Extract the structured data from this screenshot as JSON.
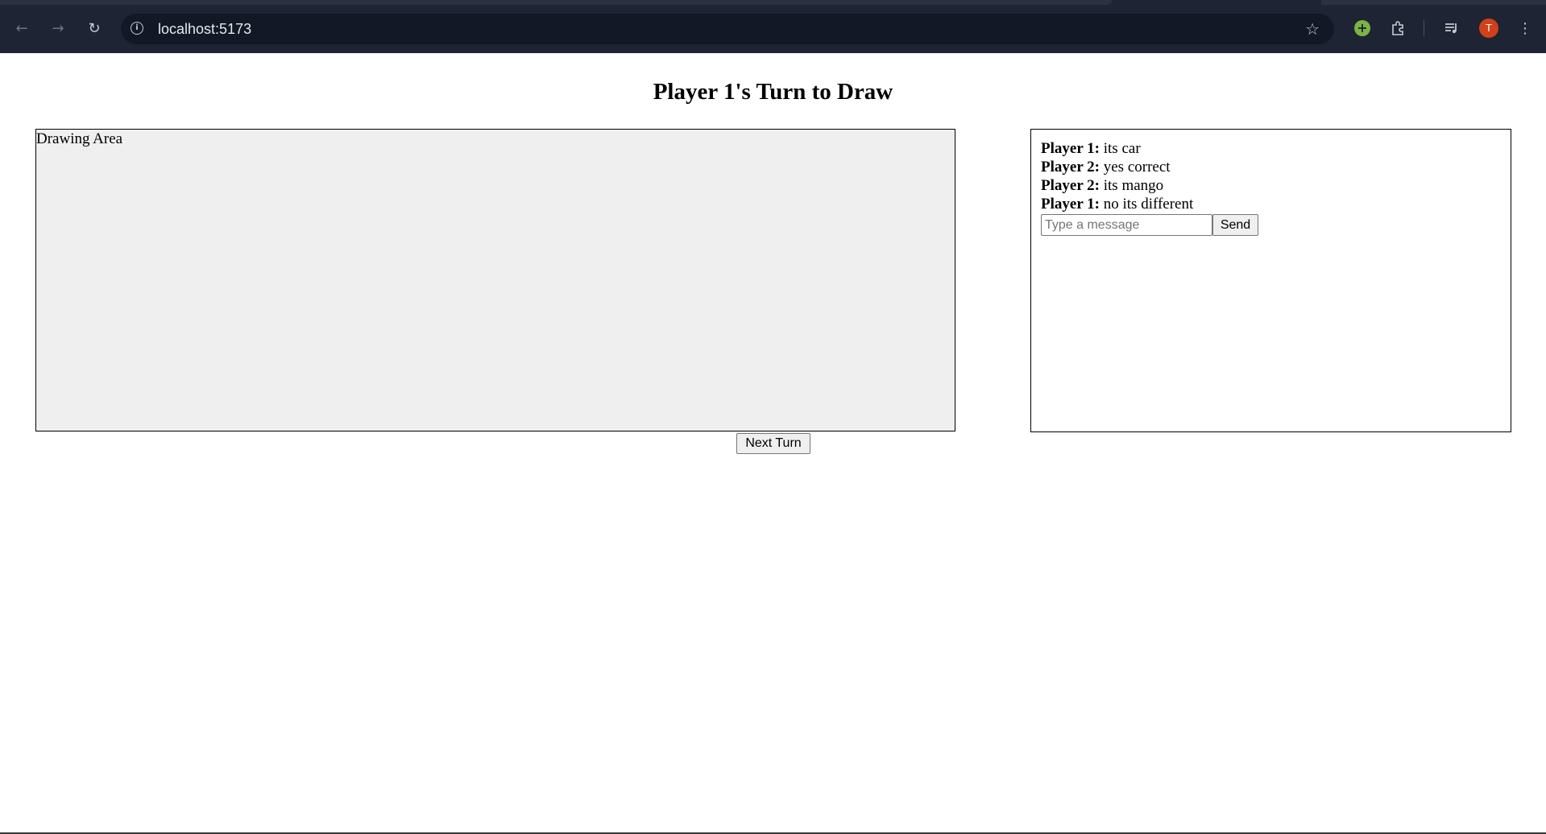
{
  "browser": {
    "url": "localhost:5173",
    "avatar_initial": "T"
  },
  "page": {
    "title": "Player 1's Turn to Draw",
    "drawing_area_label": "Drawing Area",
    "next_turn_label": "Next Turn"
  },
  "chat": {
    "messages": [
      {
        "sender": "Player 1:",
        "text": "its car"
      },
      {
        "sender": "Player 2:",
        "text": "yes correct"
      },
      {
        "sender": "Player 2:",
        "text": "its mango"
      },
      {
        "sender": "Player 1:",
        "text": "no its different"
      }
    ],
    "input_value": "",
    "input_placeholder": "Type a message",
    "send_label": "Send"
  },
  "icons": {
    "back": "back-arrow-icon",
    "forward": "forward-arrow-icon",
    "reload": "reload-icon",
    "info": "site-info-icon",
    "bookmark": "star-icon",
    "extension_green": "extension-plus-icon",
    "extensions": "puzzle-icon",
    "media": "media-queue-icon",
    "menu": "kebab-menu-icon"
  },
  "colors": {
    "chrome_bg": "#1e2433",
    "omnibox_bg": "#121826",
    "drawing_bg": "#efefef",
    "avatar_bg": "#d0401b",
    "extension_green": "#7cb342"
  }
}
